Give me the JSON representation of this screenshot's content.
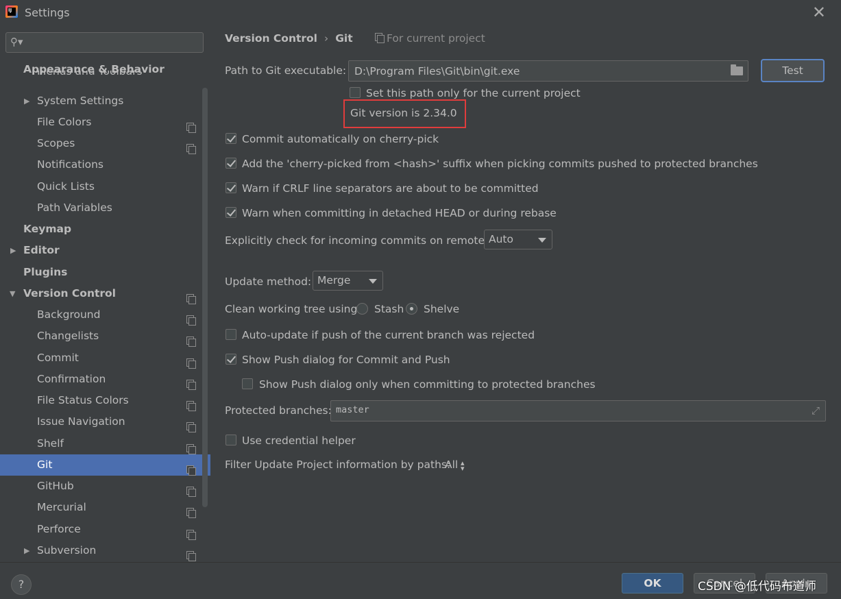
{
  "window": {
    "title": "Settings",
    "close_glyph": "✕"
  },
  "sidebar": {
    "search_placeholder": "",
    "items": [
      {
        "label": "Appearance & Behavior",
        "bold": true
      },
      {
        "label": "Menus and Toolbars"
      },
      {
        "label": "System Settings"
      },
      {
        "label": "File Colors"
      },
      {
        "label": "Scopes"
      },
      {
        "label": "Notifications"
      },
      {
        "label": "Quick Lists"
      },
      {
        "label": "Path Variables"
      },
      {
        "label": "Keymap",
        "bold": true
      },
      {
        "label": "Editor",
        "bold": true
      },
      {
        "label": "Plugins",
        "bold": true
      },
      {
        "label": "Version Control",
        "bold": true
      },
      {
        "label": "Background"
      },
      {
        "label": "Changelists"
      },
      {
        "label": "Commit"
      },
      {
        "label": "Confirmation"
      },
      {
        "label": "File Status Colors"
      },
      {
        "label": "Issue Navigation"
      },
      {
        "label": "Shelf"
      },
      {
        "label": "Git"
      },
      {
        "label": "GitHub"
      },
      {
        "label": "Mercurial"
      },
      {
        "label": "Perforce"
      },
      {
        "label": "Subversion"
      }
    ]
  },
  "breadcrumb": {
    "parent": "Version Control",
    "separator": "›",
    "current": "Git",
    "scope": "For current project"
  },
  "git": {
    "path_label": "Path to Git executable:",
    "path_value": "D:\\Program Files\\Git\\bin\\git.exe",
    "test_label": "Test",
    "set_path_only_label": "Set this path only for the current project",
    "version_text": "Git version is 2.34.0",
    "commit_cherry_pick": "Commit automatically on cherry-pick",
    "add_suffix": "Add the 'cherry-picked from <hash>' suffix when picking commits pushed to protected branches",
    "warn_crlf": "Warn if CRLF line separators are about to be committed",
    "warn_detached": "Warn when committing in detached HEAD or during rebase",
    "incoming_label": "Explicitly check for incoming commits on remotes:",
    "incoming_value": "Auto",
    "update_method_label": "Update method:",
    "update_method_value": "Merge",
    "clean_tree_label": "Clean working tree using:",
    "stash_label": "Stash",
    "shelve_label": "Shelve",
    "auto_update_label": "Auto-update if push of the current branch was rejected",
    "show_push_label": "Show Push dialog for Commit and Push",
    "show_push_protected_label": "Show Push dialog only when committing to protected branches",
    "protected_label": "Protected branches:",
    "protected_value": "master",
    "credential_label": "Use credential helper",
    "filter_label": "Filter Update Project information by paths:",
    "filter_value": "All"
  },
  "footer": {
    "help": "?",
    "ok": "OK",
    "cancel": "Cancel",
    "apply": "Apply"
  },
  "watermark": "CSDN @低代码布道师",
  "colors": {
    "selection": "#4b6eaf",
    "highlight_border": "#e03c3c",
    "ok_button": "#365880"
  }
}
